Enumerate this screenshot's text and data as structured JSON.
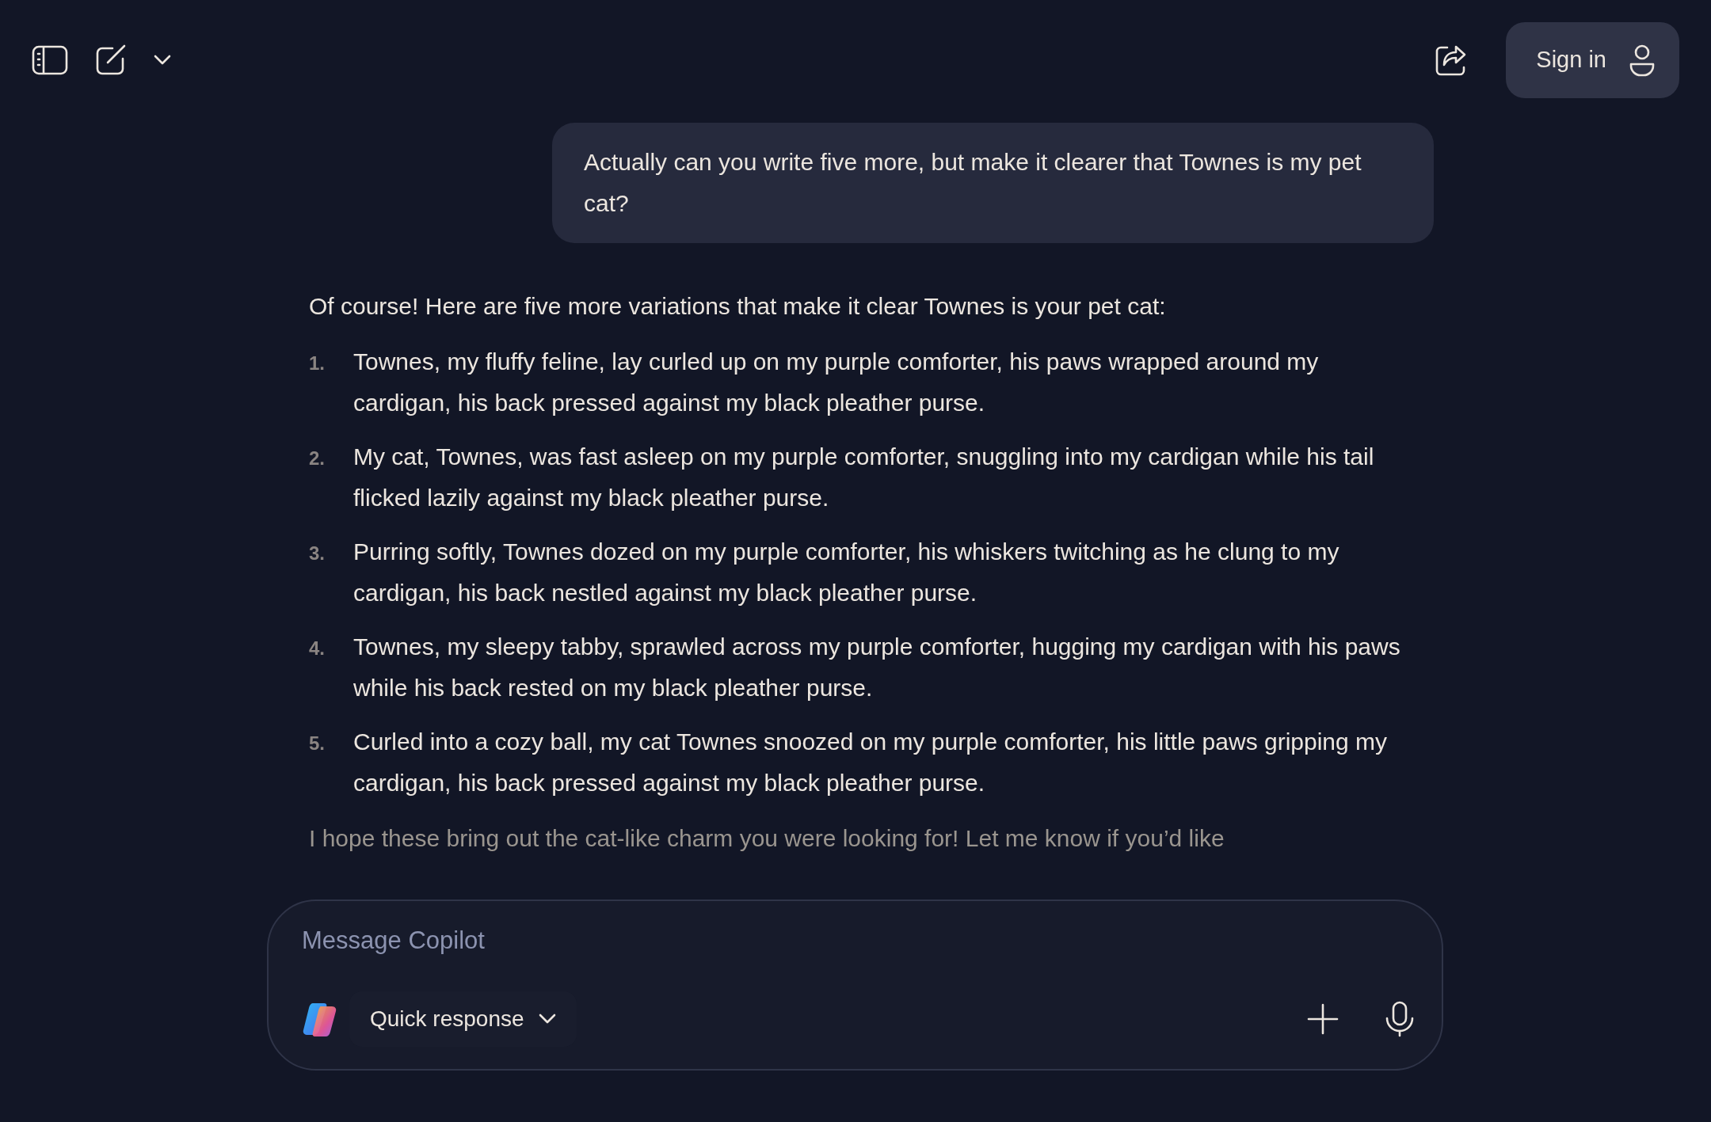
{
  "toolbar": {
    "sign_in": "Sign in"
  },
  "user_message": "Actually can you write five more, but make it clearer that Townes is my pet cat?",
  "assistant": {
    "intro": "Of course! Here are five more variations that make it clear Townes is your pet cat:",
    "items": [
      {
        "number": "1.",
        "text": "Townes, my fluffy feline, lay curled up on my purple comforter, his paws wrapped around my cardigan, his back pressed against my black pleather purse."
      },
      {
        "number": "2.",
        "text": "My cat, Townes, was fast asleep on my purple comforter, snuggling into my cardigan while his tail flicked lazily against my black pleather purse."
      },
      {
        "number": "3.",
        "text": "Purring softly, Townes dozed on my purple comforter, his whiskers twitching as he clung to my cardigan, his back nestled against my black pleather purse."
      },
      {
        "number": "4.",
        "text": "Townes, my sleepy tabby, sprawled across my purple comforter, hugging my cardigan with his paws while his back rested on my black pleather purse."
      },
      {
        "number": "5.",
        "text": "Curled into a cozy ball, my cat Townes snoozed on my purple comforter, his little paws gripping my cardigan, his back pressed against my black pleather purse."
      }
    ],
    "closing": "I hope these bring out the cat-like charm you were looking for! Let me know if you’d like"
  },
  "composer": {
    "placeholder": "Message Copilot",
    "mode": "Quick response"
  }
}
